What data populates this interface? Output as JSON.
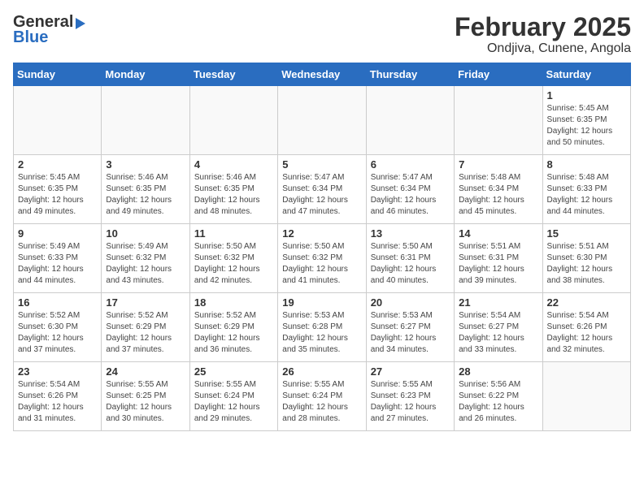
{
  "header": {
    "logo_line1": "General",
    "logo_line2": "Blue",
    "title": "February 2025",
    "subtitle": "Ondjiva, Cunene, Angola"
  },
  "days_of_week": [
    "Sunday",
    "Monday",
    "Tuesday",
    "Wednesday",
    "Thursday",
    "Friday",
    "Saturday"
  ],
  "weeks": [
    [
      {
        "num": "",
        "info": ""
      },
      {
        "num": "",
        "info": ""
      },
      {
        "num": "",
        "info": ""
      },
      {
        "num": "",
        "info": ""
      },
      {
        "num": "",
        "info": ""
      },
      {
        "num": "",
        "info": ""
      },
      {
        "num": "1",
        "info": "Sunrise: 5:45 AM\nSunset: 6:35 PM\nDaylight: 12 hours\nand 50 minutes."
      }
    ],
    [
      {
        "num": "2",
        "info": "Sunrise: 5:45 AM\nSunset: 6:35 PM\nDaylight: 12 hours\nand 49 minutes."
      },
      {
        "num": "3",
        "info": "Sunrise: 5:46 AM\nSunset: 6:35 PM\nDaylight: 12 hours\nand 49 minutes."
      },
      {
        "num": "4",
        "info": "Sunrise: 5:46 AM\nSunset: 6:35 PM\nDaylight: 12 hours\nand 48 minutes."
      },
      {
        "num": "5",
        "info": "Sunrise: 5:47 AM\nSunset: 6:34 PM\nDaylight: 12 hours\nand 47 minutes."
      },
      {
        "num": "6",
        "info": "Sunrise: 5:47 AM\nSunset: 6:34 PM\nDaylight: 12 hours\nand 46 minutes."
      },
      {
        "num": "7",
        "info": "Sunrise: 5:48 AM\nSunset: 6:34 PM\nDaylight: 12 hours\nand 45 minutes."
      },
      {
        "num": "8",
        "info": "Sunrise: 5:48 AM\nSunset: 6:33 PM\nDaylight: 12 hours\nand 44 minutes."
      }
    ],
    [
      {
        "num": "9",
        "info": "Sunrise: 5:49 AM\nSunset: 6:33 PM\nDaylight: 12 hours\nand 44 minutes."
      },
      {
        "num": "10",
        "info": "Sunrise: 5:49 AM\nSunset: 6:32 PM\nDaylight: 12 hours\nand 43 minutes."
      },
      {
        "num": "11",
        "info": "Sunrise: 5:50 AM\nSunset: 6:32 PM\nDaylight: 12 hours\nand 42 minutes."
      },
      {
        "num": "12",
        "info": "Sunrise: 5:50 AM\nSunset: 6:32 PM\nDaylight: 12 hours\nand 41 minutes."
      },
      {
        "num": "13",
        "info": "Sunrise: 5:50 AM\nSunset: 6:31 PM\nDaylight: 12 hours\nand 40 minutes."
      },
      {
        "num": "14",
        "info": "Sunrise: 5:51 AM\nSunset: 6:31 PM\nDaylight: 12 hours\nand 39 minutes."
      },
      {
        "num": "15",
        "info": "Sunrise: 5:51 AM\nSunset: 6:30 PM\nDaylight: 12 hours\nand 38 minutes."
      }
    ],
    [
      {
        "num": "16",
        "info": "Sunrise: 5:52 AM\nSunset: 6:30 PM\nDaylight: 12 hours\nand 37 minutes."
      },
      {
        "num": "17",
        "info": "Sunrise: 5:52 AM\nSunset: 6:29 PM\nDaylight: 12 hours\nand 37 minutes."
      },
      {
        "num": "18",
        "info": "Sunrise: 5:52 AM\nSunset: 6:29 PM\nDaylight: 12 hours\nand 36 minutes."
      },
      {
        "num": "19",
        "info": "Sunrise: 5:53 AM\nSunset: 6:28 PM\nDaylight: 12 hours\nand 35 minutes."
      },
      {
        "num": "20",
        "info": "Sunrise: 5:53 AM\nSunset: 6:27 PM\nDaylight: 12 hours\nand 34 minutes."
      },
      {
        "num": "21",
        "info": "Sunrise: 5:54 AM\nSunset: 6:27 PM\nDaylight: 12 hours\nand 33 minutes."
      },
      {
        "num": "22",
        "info": "Sunrise: 5:54 AM\nSunset: 6:26 PM\nDaylight: 12 hours\nand 32 minutes."
      }
    ],
    [
      {
        "num": "23",
        "info": "Sunrise: 5:54 AM\nSunset: 6:26 PM\nDaylight: 12 hours\nand 31 minutes."
      },
      {
        "num": "24",
        "info": "Sunrise: 5:55 AM\nSunset: 6:25 PM\nDaylight: 12 hours\nand 30 minutes."
      },
      {
        "num": "25",
        "info": "Sunrise: 5:55 AM\nSunset: 6:24 PM\nDaylight: 12 hours\nand 29 minutes."
      },
      {
        "num": "26",
        "info": "Sunrise: 5:55 AM\nSunset: 6:24 PM\nDaylight: 12 hours\nand 28 minutes."
      },
      {
        "num": "27",
        "info": "Sunrise: 5:55 AM\nSunset: 6:23 PM\nDaylight: 12 hours\nand 27 minutes."
      },
      {
        "num": "28",
        "info": "Sunrise: 5:56 AM\nSunset: 6:22 PM\nDaylight: 12 hours\nand 26 minutes."
      },
      {
        "num": "",
        "info": ""
      }
    ]
  ]
}
